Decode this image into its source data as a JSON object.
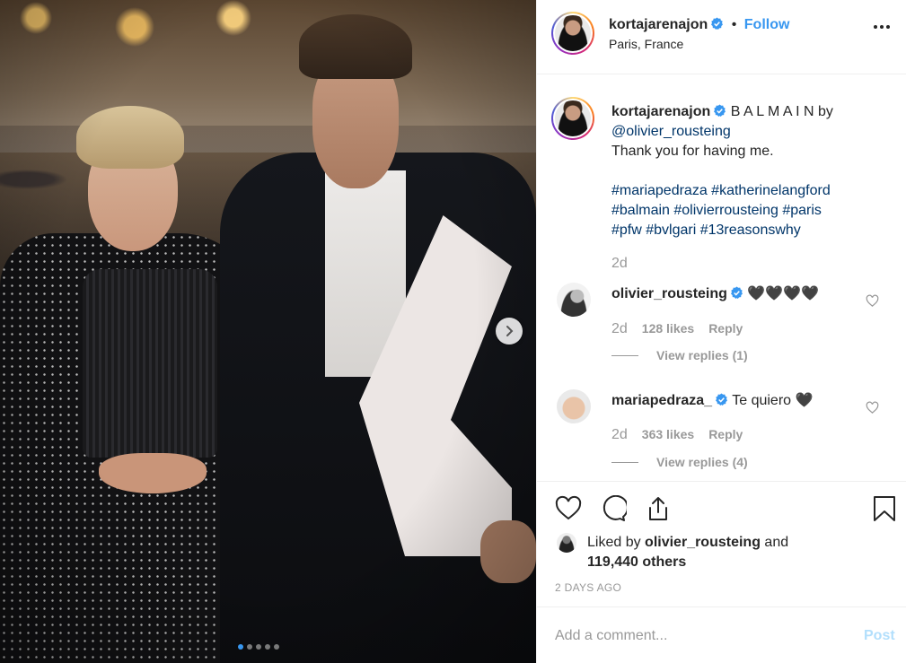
{
  "post": {
    "author": "kortajarenajon",
    "follow_label": "Follow",
    "dot": "•",
    "location": "Paris, France",
    "caption": {
      "author": "kortajarenajon",
      "text_before": "B A L M A I N by",
      "mention": "@olivier_rousteing",
      "line2": "Thank you for having me.",
      "hashtags_line1": "#mariapedraza #katherinelangford",
      "hashtags_line2": "#balmain #olivierrousteing #paris",
      "hashtags_line3": "#pfw #bvlgari #13reasonswhy",
      "time": "2d"
    },
    "comments": [
      {
        "user": "olivier_rousteing",
        "text": "🖤🖤🖤🖤",
        "time": "2d",
        "likes": "128 likes",
        "reply": "Reply",
        "view_replies": "View replies (1)"
      },
      {
        "user": "mariapedraza_",
        "text": "Te quiero 🖤",
        "time": "2d",
        "likes": "363 likes",
        "reply": "Reply",
        "view_replies": "View replies (4)"
      }
    ],
    "liked_by_prefix": "Liked by",
    "liked_by_user": "olivier_rousteing",
    "liked_by_and": "and",
    "liked_by_others": "119,440 others",
    "date": "2 DAYS AGO",
    "add_comment_placeholder": "Add a comment...",
    "post_label": "Post",
    "carousel": {
      "count": 5,
      "active": 1
    }
  },
  "colors": {
    "accent": "#3897f0",
    "hashtag": "#003569",
    "muted": "#999999"
  },
  "icons": [
    "more-icon",
    "verified-icon",
    "heart-icon",
    "comment-icon",
    "share-icon",
    "bookmark-icon",
    "chevron-right-icon"
  ]
}
